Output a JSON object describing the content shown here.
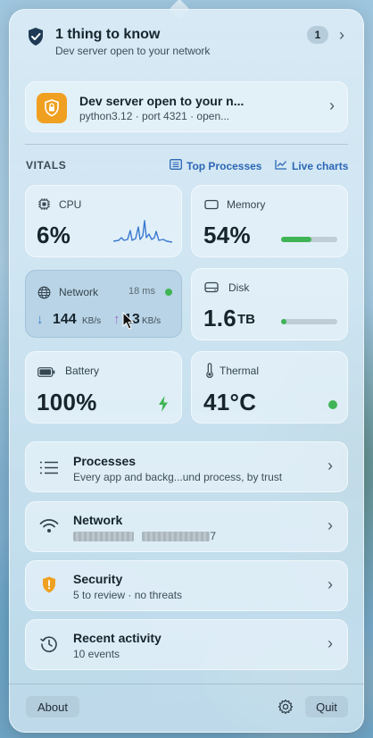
{
  "header": {
    "title": "1 thing to know",
    "subtitle": "Dev server open to your network",
    "count": "1"
  },
  "alert": {
    "title": "Dev server open to your n...",
    "subtitle": "python3.12 · port 4321 · open..."
  },
  "vitals": {
    "label": "VITALS",
    "top_processes": "Top Processes",
    "live_charts": "Live charts",
    "cpu": {
      "label": "CPU",
      "value": "6%"
    },
    "memory": {
      "label": "Memory",
      "value": "54%",
      "fill": 0.54
    },
    "network": {
      "label": "Network",
      "latency": "18 ms",
      "down_value": "144",
      "down_unit": "KB/s",
      "up_value": "13",
      "up_unit": "KB/s"
    },
    "disk": {
      "label": "Disk",
      "value": "1.6",
      "unit": "TB",
      "fill": 0.1
    },
    "battery": {
      "label": "Battery",
      "value": "100%"
    },
    "thermal": {
      "label": "Thermal",
      "value": "41°C"
    }
  },
  "rows": {
    "processes": {
      "title": "Processes",
      "subtitle": "Every app and backg...und process, by trust"
    },
    "network": {
      "title": "Network",
      "subtitle_tail": "7"
    },
    "security": {
      "title": "Security",
      "subtitle": "5 to review · no threats"
    },
    "activity": {
      "title": "Recent activity",
      "subtitle": "10 events"
    }
  },
  "footer": {
    "about": "About",
    "quit": "Quit"
  },
  "colors": {
    "accent_green": "#3fb455",
    "link_blue": "#2b66b5",
    "alert_orange": "#f0a020",
    "upload_purple": "#9a6fd0",
    "download_blue": "#3a79d0"
  }
}
